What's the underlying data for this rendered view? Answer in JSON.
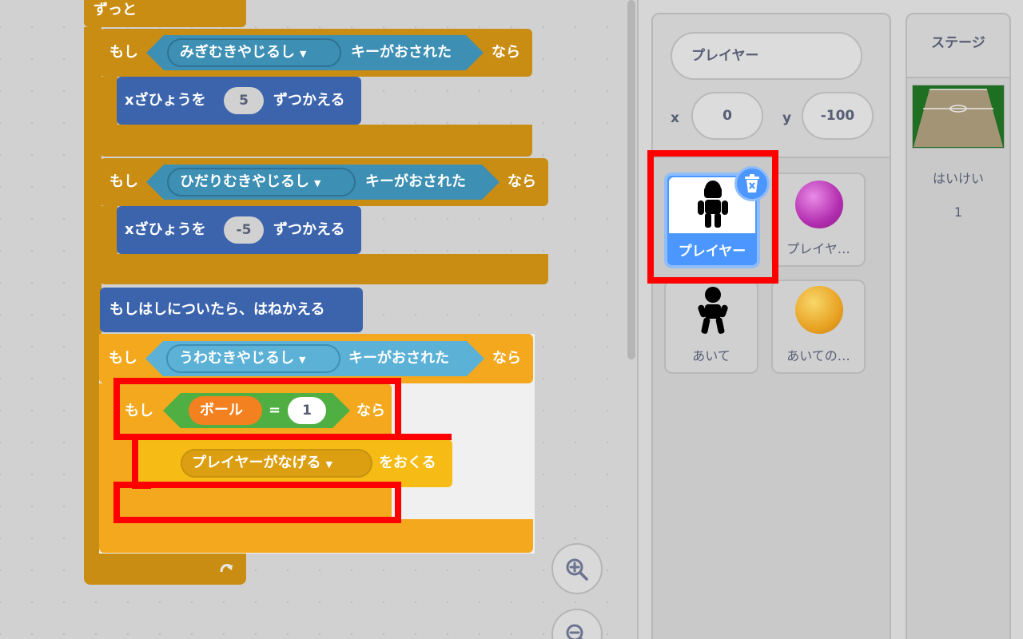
{
  "script": {
    "forever_label": "ずっと",
    "if_right": {
      "if_label": "もし",
      "key": "みぎむきやじるし",
      "pressed_label": "キーがおされた",
      "then_label": "なら",
      "change_x_label": "xざひょうを",
      "change_x_value": "5",
      "change_x_suffix": "ずつかえる"
    },
    "if_left": {
      "if_label": "もし",
      "key": "ひだりむきやじるし",
      "pressed_label": "キーがおされた",
      "then_label": "なら",
      "change_x_label": "xざひょうを",
      "change_x_value": "-5",
      "change_x_suffix": "ずつかえる"
    },
    "bounce_label": "もしはしについたら、はねかえる",
    "if_up": {
      "if_label": "もし",
      "key": "うわむきやじるし",
      "pressed_label": "キーがおされた",
      "then_label": "なら"
    },
    "if_ball": {
      "if_label": "もし",
      "variable": "ボール",
      "equals": "=",
      "value": "1",
      "then_label": "なら"
    },
    "broadcast": {
      "message": "プレイヤーがなげる",
      "suffix": "をおくる"
    }
  },
  "sprite_info": {
    "name_value": "プレイヤー",
    "x_label": "x",
    "x_value": "0",
    "y_label": "y",
    "y_value": "-100"
  },
  "sprites": [
    {
      "label": "プレイヤー",
      "icon": "player-silhouette-icon",
      "selected": true
    },
    {
      "label": "プレイヤ…",
      "icon": "magenta-ball-icon"
    },
    {
      "label": "あいて",
      "icon": "opponent-silhouette-icon"
    },
    {
      "label": "あいての…",
      "icon": "orange-ball-icon"
    }
  ],
  "stage": {
    "title": "ステージ",
    "backdrop_label": "はいけい",
    "backdrop_count": "1"
  },
  "colors": {
    "control": "#f4a81d",
    "sensing": "#5cb1d6",
    "operator": "#4faf42",
    "variable": "#f48120",
    "event": "#f6bb14",
    "motion": "#4c97ff",
    "highlight": "#ff0000"
  }
}
